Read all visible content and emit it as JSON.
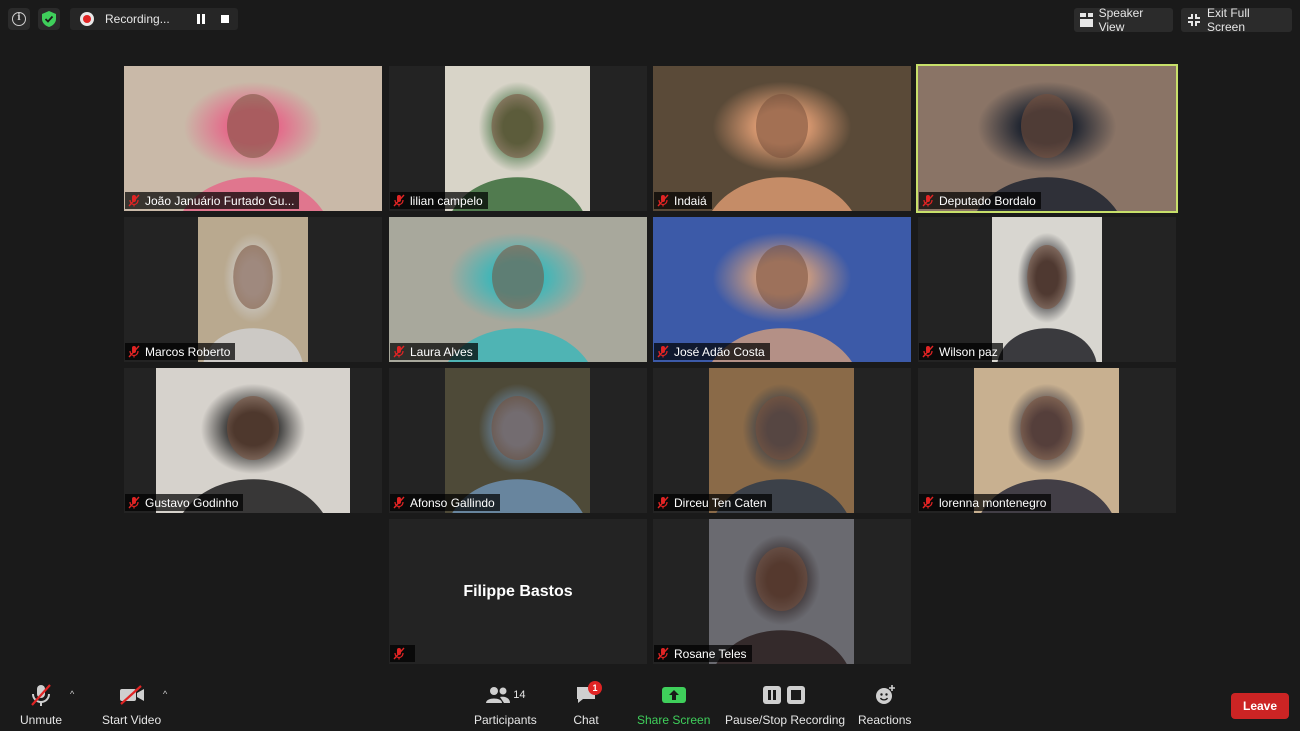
{
  "recording": {
    "label": "Recording..."
  },
  "top_buttons": {
    "speaker_view": "Speaker View",
    "exit_full_screen": "Exit Full Screen"
  },
  "participants": [
    {
      "name": "João Januário Furtado Gu...",
      "video_bg": "#c9b9a8",
      "accent": "#e46a8a"
    },
    {
      "name": "lilian campelo",
      "video_bg": "#d8d4c8",
      "accent": "#3a6b3a"
    },
    {
      "name": "Indaiá",
      "video_bg": "#5a4a38",
      "accent": "#d89870"
    },
    {
      "name": "Deputado Bordalo",
      "video_bg": "#8a7466",
      "accent": "#1e2430"
    },
    {
      "name": "Marcos Roberto",
      "video_bg": "#b9a98f",
      "accent": "#cfcfcf"
    },
    {
      "name": "Laura Alves",
      "video_bg": "#a8a89c",
      "accent": "#3fb6b8"
    },
    {
      "name": "José Adão Costa",
      "video_bg": "#3c5aa8",
      "accent": "#c99a80"
    },
    {
      "name": "Wilson paz",
      "video_bg": "#d8d6d0",
      "accent": "#1e1e24"
    },
    {
      "name": "Gustavo Godinho",
      "video_bg": "#d6d2cc",
      "accent": "#1c1c1c"
    },
    {
      "name": "Afonso Gallindo",
      "video_bg": "#4e4a38",
      "accent": "#6d8fb0"
    },
    {
      "name": "Dirceu Ten Caten",
      "video_bg": "#8a6a48",
      "accent": "#2e3a4a"
    },
    {
      "name": "lorenna montenegro",
      "video_bg": "#c8b090",
      "accent": "#2a2a3a"
    },
    {
      "name": "Filippe Bastos"
    },
    {
      "name": "Rosane Teles",
      "video_bg": "#6a6a70",
      "accent": "#2a1e1e"
    }
  ],
  "toolbar": {
    "unmute": "Unmute",
    "start_video": "Start Video",
    "participants_count": "14",
    "participants": "Participants",
    "chat": "Chat",
    "chat_badge": "1",
    "share_screen": "Share Screen",
    "pause_stop_recording": "Pause/Stop Recording",
    "reactions": "Reactions",
    "leave": "Leave"
  },
  "colors": {
    "active_speaker_border": "#c8e06a",
    "share_green": "#3fcf5b",
    "leave_red": "#cc2424",
    "muted_red": "#e02424"
  }
}
